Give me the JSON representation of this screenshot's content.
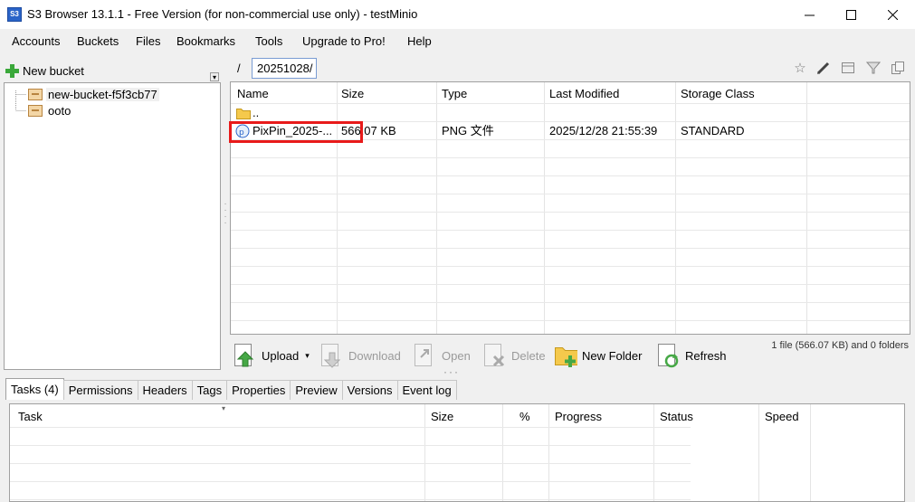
{
  "window": {
    "title": "S3 Browser 13.1.1 - Free Version (for non-commercial use only) - testMinio",
    "app_icon_text": "S3",
    "minimize": "–",
    "maximize": "☐",
    "close": "✕"
  },
  "menu": [
    "Accounts",
    "Buckets",
    "Files",
    "Bookmarks",
    "Tools",
    "Upgrade to Pro!",
    "Help"
  ],
  "left_panel": {
    "new_bucket_label": "New bucket",
    "buckets": [
      "new-bucket-f5f3cb77",
      "ooto"
    ]
  },
  "path": {
    "root": "/",
    "current": "20251028/"
  },
  "file_grid": {
    "columns": [
      "Name",
      "Size",
      "Type",
      "Last Modified",
      "Storage Class"
    ],
    "parent_row": "..",
    "rows": [
      {
        "name": "PixPin_2025-...",
        "size": "566.07 KB",
        "type": "PNG 文件",
        "modified": "2025/12/28 21:55:39",
        "storage": "STANDARD"
      }
    ]
  },
  "actions": {
    "upload": "Upload",
    "download": "Download",
    "open": "Open",
    "delete": "Delete",
    "new_folder": "New Folder",
    "refresh": "Refresh",
    "file_count": "1 file (566.07 KB) and 0 folders"
  },
  "tabs": [
    "Tasks (4)",
    "Permissions",
    "Headers",
    "Tags",
    "Properties",
    "Preview",
    "Versions",
    "Event log"
  ],
  "tasks_columns": [
    "Task",
    "Size",
    "%",
    "Progress",
    "Status",
    "Speed"
  ],
  "colors": {
    "highlight_border": "#e81a1a",
    "path_box_border": "#7a9cd3",
    "disabled_text": "#9a9a9a"
  }
}
